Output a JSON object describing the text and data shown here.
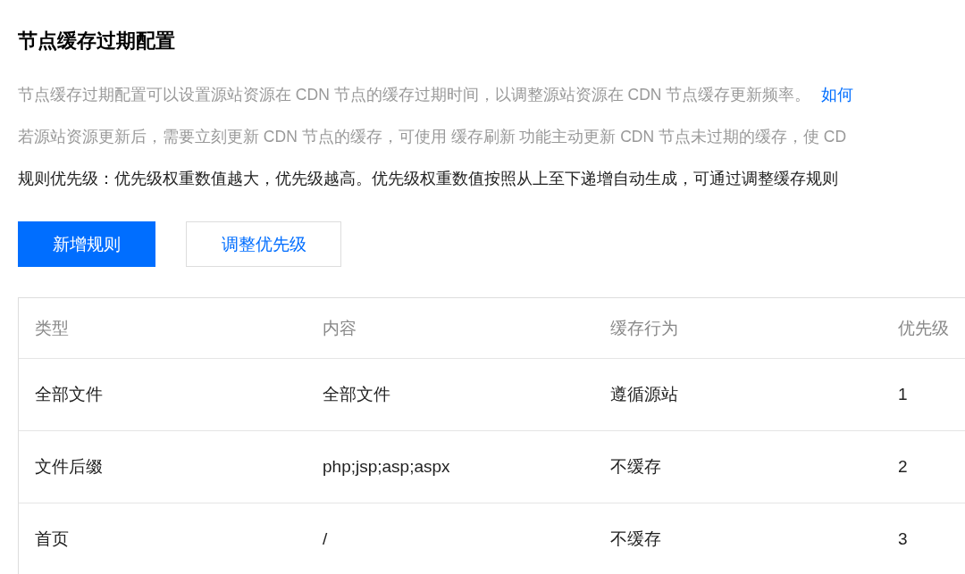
{
  "title": "节点缓存过期配置",
  "descriptions": [
    {
      "text": "节点缓存过期配置可以设置源站资源在 CDN 节点的缓存过期时间，以调整源站资源在 CDN 节点缓存更新频率。",
      "link": "如何"
    },
    {
      "text": "若源站资源更新后，需要立刻更新 CDN 节点的缓存，可使用 缓存刷新 功能主动更新 CDN 节点未过期的缓存，使 CD"
    }
  ],
  "priority_note": "规则优先级：优先级权重数值越大，优先级越高。优先级权重数值按照从上至下递增自动生成，可通过调整缓存规则",
  "buttons": [
    {
      "label": "新增规则",
      "kind": "primary"
    },
    {
      "label": "调整优先级",
      "kind": "secondary"
    }
  ],
  "table": {
    "columns": [
      "类型",
      "内容",
      "缓存行为",
      "优先级"
    ],
    "rows": [
      [
        "全部文件",
        "全部文件",
        "遵循源站",
        "1"
      ],
      [
        "文件后缀",
        "php;jsp;asp;aspx",
        "不缓存",
        "2"
      ],
      [
        "首页",
        "/",
        "不缓存",
        "3"
      ]
    ]
  }
}
